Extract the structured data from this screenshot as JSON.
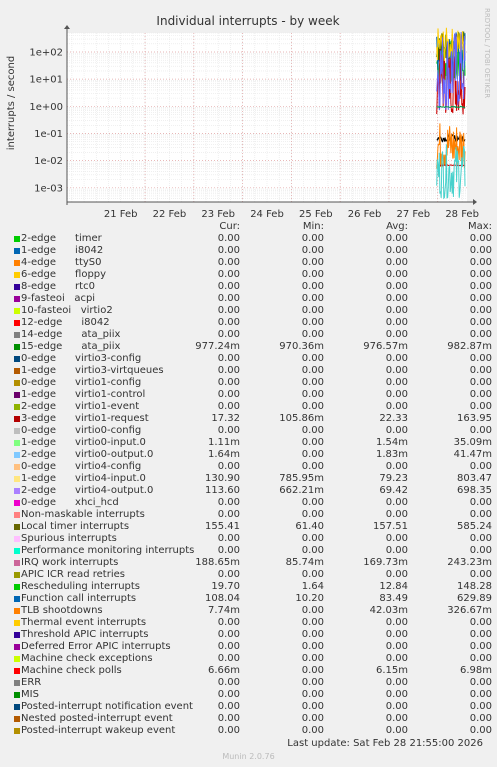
{
  "title": "Individual interrupts - by week",
  "side_label": "RRDTOOL / TOBI OETIKER",
  "ylabel": "interrupts / second",
  "chart_data": {
    "type": "line",
    "title": "Individual interrupts - by week",
    "ylabel": "interrupts / second",
    "yscale": "log",
    "ylim": [
      0.0003,
      500
    ],
    "y_ticks": [
      {
        "value": 100,
        "label": "1e+02"
      },
      {
        "value": 10,
        "label": "1e+01"
      },
      {
        "value": 1,
        "label": "1e+00"
      },
      {
        "value": 0.1,
        "label": "1e-01"
      },
      {
        "value": 0.01,
        "label": "1e-02"
      },
      {
        "value": 0.001,
        "label": "1e-03"
      }
    ],
    "x_ticks": [
      "21 Feb",
      "22 Feb",
      "23 Feb",
      "24 Feb",
      "25 Feb",
      "26 Feb",
      "27 Feb",
      "28 Feb"
    ],
    "grid": true,
    "data_window": {
      "start": "28 Feb",
      "end": "28 Feb 21:55"
    },
    "series_bands": [
      {
        "name": "timer",
        "color": "#00cc00",
        "low": 5,
        "high": 300
      },
      {
        "name": "Function call interrupts",
        "color": "#0066b3",
        "low": 8,
        "high": 600
      },
      {
        "name": "virtio1-request",
        "color": "#cc0000",
        "low": 0.5,
        "high": 160
      },
      {
        "name": "Local timer interrupts",
        "color": "#336600",
        "low": 50,
        "high": 580
      },
      {
        "name": "virtio4-input.0",
        "color": "#ffcc00",
        "low": 40,
        "high": 800
      },
      {
        "name": "virtio4-output.0",
        "color": "#6666ff",
        "low": 0.6,
        "high": 700
      },
      {
        "name": "ata_piix (15-edge)",
        "color": "#00994d",
        "low": 0.9,
        "high": 1.0
      },
      {
        "name": "ata_piix (14-edge)",
        "color": "#000000",
        "low": 0.05,
        "high": 0.09
      },
      {
        "name": "TLB shootdowns",
        "color": "#ff8000",
        "low": 0.004,
        "high": 0.3
      },
      {
        "name": "Machine check polls",
        "color": "#cc0000",
        "low": 0.0065,
        "high": 0.007
      },
      {
        "name": "virtio0-output.0",
        "color": "#48d1cc",
        "low": 0.0004,
        "high": 0.04
      }
    ]
  },
  "legend": {
    "headers": {
      "cur": "Cur:",
      "min": "Min:",
      "avg": "Avg:",
      "max": "Max:"
    },
    "rows": [
      {
        "name": "2-edge      timer",
        "color": "#00cc00",
        "cur": "0.00",
        "min": "0.00",
        "avg": "0.00",
        "max": "0.00"
      },
      {
        "name": "1-edge      i8042",
        "color": "#0066b3",
        "cur": "0.00",
        "min": "0.00",
        "avg": "0.00",
        "max": "0.00"
      },
      {
        "name": "4-edge      ttyS0",
        "color": "#ff8000",
        "cur": "0.00",
        "min": "0.00",
        "avg": "0.00",
        "max": "0.00"
      },
      {
        "name": "6-edge      floppy",
        "color": "#ffcc00",
        "cur": "0.00",
        "min": "0.00",
        "avg": "0.00",
        "max": "0.00"
      },
      {
        "name": "8-edge      rtc0",
        "color": "#330099",
        "cur": "0.00",
        "min": "0.00",
        "avg": "0.00",
        "max": "0.00"
      },
      {
        "name": "9-fasteoi   acpi",
        "color": "#990099",
        "cur": "0.00",
        "min": "0.00",
        "avg": "0.00",
        "max": "0.00"
      },
      {
        "name": "10-fasteoi   virtio2",
        "color": "#ccff00",
        "cur": "0.00",
        "min": "0.00",
        "avg": "0.00",
        "max": "0.00"
      },
      {
        "name": "12-edge      i8042",
        "color": "#ff0000",
        "cur": "0.00",
        "min": "0.00",
        "avg": "0.00",
        "max": "0.00"
      },
      {
        "name": "14-edge      ata_piix",
        "color": "#808080",
        "cur": "0.00",
        "min": "0.00",
        "avg": "0.00",
        "max": "0.00"
      },
      {
        "name": "15-edge      ata_piix",
        "color": "#008f00",
        "cur": "977.24m",
        "min": "970.36m",
        "avg": "976.57m",
        "max": "982.87m"
      },
      {
        "name": "0-edge      virtio3-config",
        "color": "#00487d",
        "cur": "0.00",
        "min": "0.00",
        "avg": "0.00",
        "max": "0.00"
      },
      {
        "name": "1-edge      virtio3-virtqueues",
        "color": "#b35a00",
        "cur": "0.00",
        "min": "0.00",
        "avg": "0.00",
        "max": "0.00"
      },
      {
        "name": "0-edge      virtio1-config",
        "color": "#b38f00",
        "cur": "0.00",
        "min": "0.00",
        "avg": "0.00",
        "max": "0.00"
      },
      {
        "name": "1-edge      virtio1-control",
        "color": "#6b006b",
        "cur": "0.00",
        "min": "0.00",
        "avg": "0.00",
        "max": "0.00"
      },
      {
        "name": "2-edge      virtio1-event",
        "color": "#8fb300",
        "cur": "0.00",
        "min": "0.00",
        "avg": "0.00",
        "max": "0.00"
      },
      {
        "name": "3-edge      virtio1-request",
        "color": "#b30000",
        "cur": "17.32",
        "min": "105.86m",
        "avg": "22.33",
        "max": "163.95"
      },
      {
        "name": "0-edge      virtio0-config",
        "color": "#bebebe",
        "cur": "0.00",
        "min": "0.00",
        "avg": "0.00",
        "max": "0.00"
      },
      {
        "name": "1-edge      virtio0-input.0",
        "color": "#80ff80",
        "cur": "1.11m",
        "min": "0.00",
        "avg": "1.54m",
        "max": "35.09m"
      },
      {
        "name": "2-edge      virtio0-output.0",
        "color": "#80c9ff",
        "cur": "1.64m",
        "min": "0.00",
        "avg": "1.83m",
        "max": "41.47m"
      },
      {
        "name": "0-edge      virtio4-config",
        "color": "#ffc080",
        "cur": "0.00",
        "min": "0.00",
        "avg": "0.00",
        "max": "0.00"
      },
      {
        "name": "1-edge      virtio4-input.0",
        "color": "#ffe680",
        "cur": "130.90",
        "min": "785.95m",
        "avg": "79.23",
        "max": "803.47"
      },
      {
        "name": "2-edge      virtio4-output.0",
        "color": "#aa80ff",
        "cur": "113.60",
        "min": "662.21m",
        "avg": "69.42",
        "max": "698.35"
      },
      {
        "name": "0-edge      xhci_hcd",
        "color": "#ee00cc",
        "cur": "0.00",
        "min": "0.00",
        "avg": "0.00",
        "max": "0.00"
      },
      {
        "name": "Non-maskable interrupts",
        "color": "#ff8080",
        "cur": "0.00",
        "min": "0.00",
        "avg": "0.00",
        "max": "0.00"
      },
      {
        "name": "Local timer interrupts",
        "color": "#666600",
        "cur": "155.41",
        "min": "61.40",
        "avg": "157.51",
        "max": "585.24"
      },
      {
        "name": "Spurious interrupts",
        "color": "#ffbfff",
        "cur": "0.00",
        "min": "0.00",
        "avg": "0.00",
        "max": "0.00"
      },
      {
        "name": "Performance monitoring interrupts",
        "color": "#00ffcc",
        "cur": "0.00",
        "min": "0.00",
        "avg": "0.00",
        "max": "0.00"
      },
      {
        "name": "IRQ work interrupts",
        "color": "#cc6699",
        "cur": "188.65m",
        "min": "85.74m",
        "avg": "169.73m",
        "max": "243.23m"
      },
      {
        "name": "APIC ICR read retries",
        "color": "#999900",
        "cur": "0.00",
        "min": "0.00",
        "avg": "0.00",
        "max": "0.00"
      },
      {
        "name": "Rescheduling interrupts",
        "color": "#00cc00",
        "cur": "19.70",
        "min": "1.64",
        "avg": "12.84",
        "max": "148.28"
      },
      {
        "name": "Function call interrupts",
        "color": "#0066b3",
        "cur": "108.04",
        "min": "10.20",
        "avg": "83.49",
        "max": "629.89"
      },
      {
        "name": "TLB shootdowns",
        "color": "#ff8000",
        "cur": "7.74m",
        "min": "0.00",
        "avg": "42.03m",
        "max": "326.67m"
      },
      {
        "name": "Thermal event interrupts",
        "color": "#ffcc00",
        "cur": "0.00",
        "min": "0.00",
        "avg": "0.00",
        "max": "0.00"
      },
      {
        "name": "Threshold APIC interrupts",
        "color": "#330099",
        "cur": "0.00",
        "min": "0.00",
        "avg": "0.00",
        "max": "0.00"
      },
      {
        "name": "Deferred Error APIC interrupts",
        "color": "#990099",
        "cur": "0.00",
        "min": "0.00",
        "avg": "0.00",
        "max": "0.00"
      },
      {
        "name": "Machine check exceptions",
        "color": "#ccff00",
        "cur": "0.00",
        "min": "0.00",
        "avg": "0.00",
        "max": "0.00"
      },
      {
        "name": "Machine check polls",
        "color": "#ff0000",
        "cur": "6.66m",
        "min": "0.00",
        "avg": "6.15m",
        "max": "6.98m"
      },
      {
        "name": "ERR",
        "color": "#808080",
        "cur": "0.00",
        "min": "0.00",
        "avg": "0.00",
        "max": "0.00"
      },
      {
        "name": "MIS",
        "color": "#008f00",
        "cur": "0.00",
        "min": "0.00",
        "avg": "0.00",
        "max": "0.00"
      },
      {
        "name": "Posted-interrupt notification event",
        "color": "#00487d",
        "cur": "0.00",
        "min": "0.00",
        "avg": "0.00",
        "max": "0.00"
      },
      {
        "name": "Nested posted-interrupt event",
        "color": "#b35a00",
        "cur": "0.00",
        "min": "0.00",
        "avg": "0.00",
        "max": "0.00"
      },
      {
        "name": "Posted-interrupt wakeup event",
        "color": "#b38f00",
        "cur": "0.00",
        "min": "0.00",
        "avg": "0.00",
        "max": "0.00"
      }
    ]
  },
  "last_update": "Last update:  Sat Feb 28 21:55:00 2026",
  "version": "Munin 2.0.76"
}
